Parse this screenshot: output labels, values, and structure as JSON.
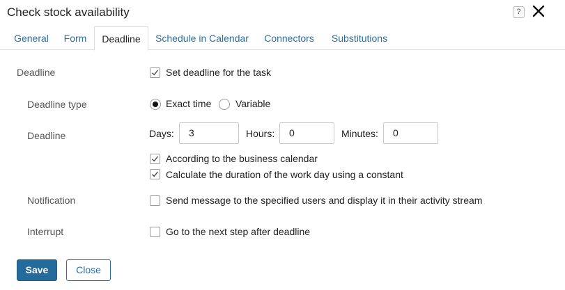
{
  "window": {
    "title": "Check stock availability",
    "help_label": "?"
  },
  "tabs": [
    {
      "label": "General"
    },
    {
      "label": "Form"
    },
    {
      "label": "Deadline",
      "active": true
    },
    {
      "label": "Schedule in Calendar"
    },
    {
      "label": "Connectors"
    },
    {
      "label": "Substitutions"
    }
  ],
  "deadline_section": {
    "label": "Deadline",
    "set_deadline": {
      "label": "Set deadline for the task",
      "checked": true
    }
  },
  "deadline_type": {
    "label": "Deadline type",
    "options": [
      {
        "label": "Exact time",
        "selected": true
      },
      {
        "label": "Variable",
        "selected": false
      }
    ]
  },
  "deadline": {
    "label": "Deadline",
    "days_label": "Days:",
    "days_value": "3",
    "hours_label": "Hours:",
    "hours_value": "0",
    "minutes_label": "Minutes:",
    "minutes_value": "0",
    "business_calendar": {
      "label": "According to the business calendar",
      "checked": true
    },
    "constant_duration": {
      "label": "Calculate the duration of the work day using a constant",
      "checked": true
    }
  },
  "notification": {
    "label": "Notification",
    "option": {
      "label": "Send message to the specified users and display it in their activity stream",
      "checked": false
    }
  },
  "interrupt": {
    "label": "Interrupt",
    "option": {
      "label": "Go to the next step after deadline",
      "checked": false
    }
  },
  "footer": {
    "save_label": "Save",
    "close_label": "Close"
  },
  "colors": {
    "accent": "#246a9a",
    "link": "#2a6fa3"
  }
}
